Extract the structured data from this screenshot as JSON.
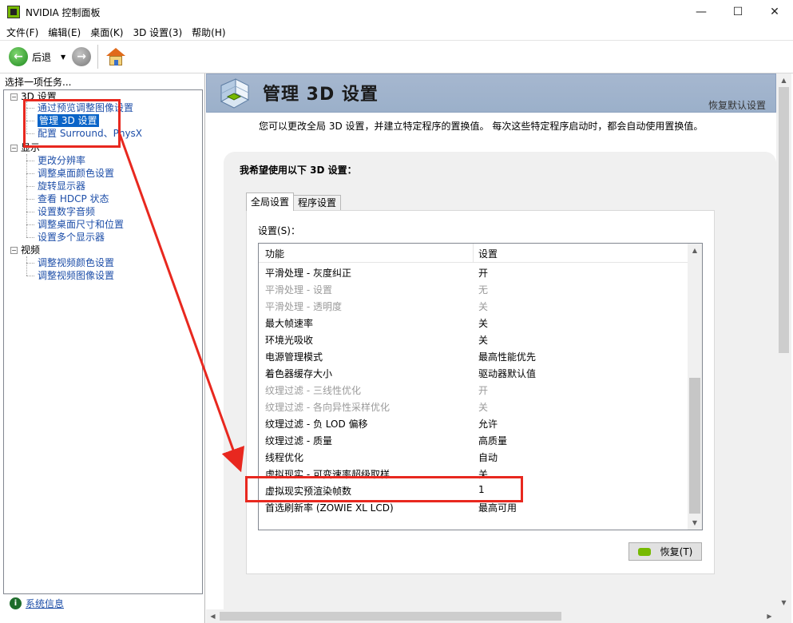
{
  "window": {
    "title": "NVIDIA 控制面板",
    "minimize": "—",
    "maximize": "☐",
    "close": "✕"
  },
  "menu": [
    "文件(F)",
    "编辑(E)",
    "桌面(K)",
    "3D 设置(3)",
    "帮助(H)"
  ],
  "toolbar": {
    "back_label": "后退",
    "dropdown": "▼"
  },
  "left": {
    "task_label": "选择一项任务...",
    "categories": [
      {
        "label": "3D 设置",
        "expander": "−",
        "items": [
          "通过预览调整图像设置",
          "管理 3D 设置",
          "配置 Surround、PhysX"
        ]
      },
      {
        "label": "显示",
        "expander": "−",
        "items": [
          "更改分辨率",
          "调整桌面颜色设置",
          "旋转显示器",
          "查看 HDCP 状态",
          "设置数字音频",
          "调整桌面尺寸和位置",
          "设置多个显示器"
        ]
      },
      {
        "label": "视频",
        "expander": "−",
        "items": [
          "调整视频颜色设置",
          "调整视频图像设置"
        ]
      }
    ],
    "selected_item": "管理 3D 设置",
    "system_info": "系统信息",
    "info_glyph": "i"
  },
  "right": {
    "page_title": "管理 3D 设置",
    "restore_defaults": "恢复默认设置",
    "description": "您可以更改全局 3D 设置，并建立特定程序的置换值。 每次这些特定程序启动时，都会自动使用置换值。",
    "panel_heading": "我希望使用以下 3D 设置：",
    "tabs": [
      "全局设置",
      "程序设置"
    ],
    "settings_label": "设置(S)：",
    "columns": [
      "功能",
      "设置"
    ],
    "rows": [
      {
        "feature": "平滑处理 - 灰度纠正",
        "value": "开",
        "disabled": false
      },
      {
        "feature": "平滑处理 - 设置",
        "value": "无",
        "disabled": true
      },
      {
        "feature": "平滑处理 - 透明度",
        "value": "关",
        "disabled": true
      },
      {
        "feature": "最大帧速率",
        "value": "关",
        "disabled": false
      },
      {
        "feature": "环境光吸收",
        "value": "关",
        "disabled": false
      },
      {
        "feature": "电源管理模式",
        "value": "最高性能优先",
        "disabled": false
      },
      {
        "feature": "着色器缓存大小",
        "value": "驱动器默认值",
        "disabled": false
      },
      {
        "feature": "纹理过滤 - 三线性优化",
        "value": "开",
        "disabled": true
      },
      {
        "feature": "纹理过滤 - 各向异性采样优化",
        "value": "关",
        "disabled": true
      },
      {
        "feature": "纹理过滤 - 负 LOD 偏移",
        "value": "允许",
        "disabled": false
      },
      {
        "feature": "纹理过滤 - 质量",
        "value": "高质量",
        "disabled": false
      },
      {
        "feature": "线程优化",
        "value": "自动",
        "disabled": false
      },
      {
        "feature": "虚拟现实 - 可变速率超级取样",
        "value": "关",
        "disabled": false
      },
      {
        "feature": "虚拟现实预渲染帧数",
        "value": "1",
        "disabled": false
      },
      {
        "feature": "首选刷新率 (ZOWIE XL LCD)",
        "value": "最高可用",
        "disabled": false
      }
    ],
    "restore_button": "恢复(T)",
    "scroll_up": "▲",
    "scroll_down": "▼",
    "scroll_left": "◀",
    "scroll_right": "▶"
  },
  "colors": {
    "annotation": "#e8281f",
    "link": "#1d4ea8",
    "selection": "#0a64c8",
    "header_band": "#a6b7cf",
    "nvidia_green": "#76b900"
  }
}
